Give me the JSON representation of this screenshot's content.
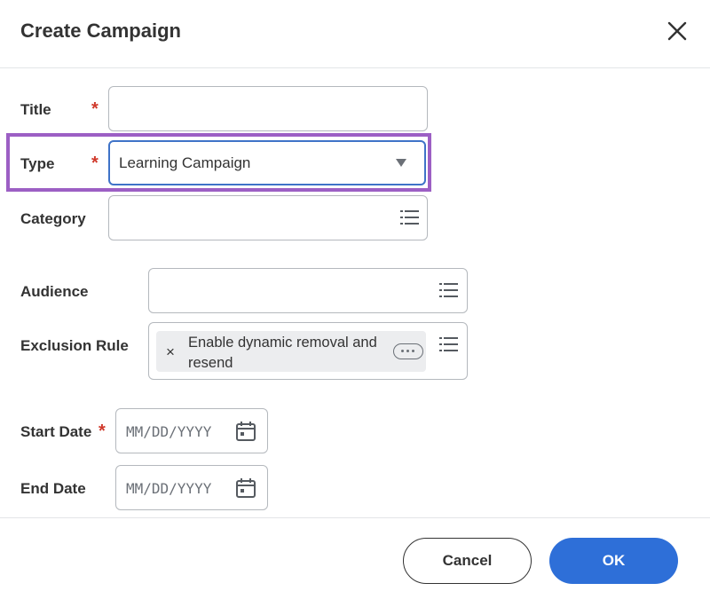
{
  "dialog": {
    "title": "Create Campaign",
    "close_icon": "close-icon"
  },
  "form": {
    "title_label": "Title",
    "title_value": "",
    "type_label": "Type",
    "type_value": "Learning Campaign",
    "category_label": "Category",
    "category_value": "",
    "audience_label": "Audience",
    "audience_value": "",
    "exclusion_label": "Exclusion Rule",
    "exclusion_selected": "Enable dynamic removal and resend",
    "start_date_label": "Start Date",
    "start_date_placeholder": "MM/DD/YYYY",
    "end_date_label": "End Date",
    "end_date_placeholder": "MM/DD/YYYY",
    "required_marker": "*",
    "remove_marker": "×"
  },
  "footer": {
    "cancel_label": "Cancel",
    "ok_label": "OK"
  },
  "colors": {
    "accent": "#2e6fd8",
    "required": "#d0392b",
    "highlight": "#9c5fc4",
    "focus_border": "#3f73c8"
  }
}
